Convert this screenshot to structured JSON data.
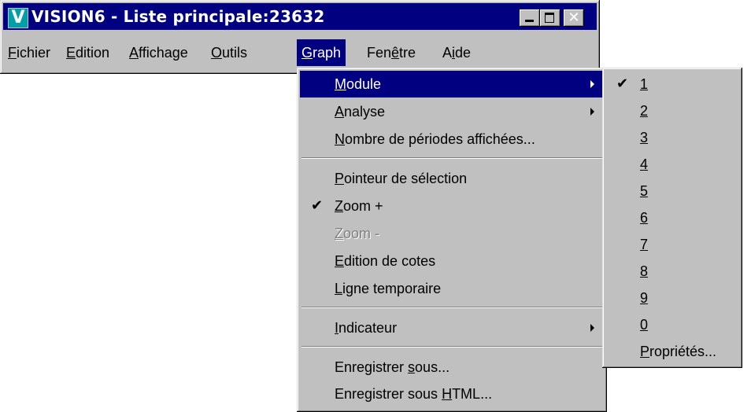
{
  "window": {
    "title": "VISION6 - Liste principale:23632",
    "app_icon_letter": "V",
    "controls": {
      "minimize": "_",
      "maximize": "□",
      "close": "✕"
    }
  },
  "menubar": {
    "items": [
      {
        "pre": "",
        "key": "F",
        "post": "ichier"
      },
      {
        "pre": "",
        "key": "E",
        "post": "dition"
      },
      {
        "pre": "",
        "key": "A",
        "post": "ffichage"
      },
      {
        "pre": "",
        "key": "O",
        "post": "utils"
      },
      {
        "pre": "",
        "key": "G",
        "post": "raph"
      },
      {
        "pre": "Fen",
        "key": "ê",
        "post": "tre"
      },
      {
        "pre": "A",
        "key": "i",
        "post": "de"
      }
    ],
    "active_index": 4
  },
  "graph_menu": {
    "module": {
      "pre": "",
      "key": "M",
      "post": "odule"
    },
    "analyse": {
      "pre": "",
      "key": "A",
      "post": "nalyse"
    },
    "periodes": {
      "pre": "",
      "key": "N",
      "post": "ombre de périodes affichées..."
    },
    "pointeur": {
      "pre": "",
      "key": "P",
      "post": "ointeur de sélection"
    },
    "zoom_plus": {
      "pre": "",
      "key": "Z",
      "post": "oom +",
      "checked": "✔"
    },
    "zoom_minus": {
      "pre": "",
      "key": "Z",
      "post": "oom -"
    },
    "edition_cotes": {
      "pre": "",
      "key": "E",
      "post": "dition de cotes"
    },
    "ligne": {
      "pre": "",
      "key": "L",
      "post": "igne temporaire"
    },
    "indicateur": {
      "pre": "",
      "key": "I",
      "post": "ndicateur"
    },
    "enregistrer": {
      "pre": "Enregistrer ",
      "key": "s",
      "post": "ous..."
    },
    "enregistrer_html": {
      "pre": "Enregistrer sous ",
      "key": "H",
      "post": "TML..."
    }
  },
  "module_menu": {
    "checked_mark": "✔",
    "items": [
      "1",
      "2",
      "3",
      "4",
      "5",
      "6",
      "7",
      "8",
      "9",
      "0"
    ],
    "proprietes": {
      "pre": "",
      "key": "P",
      "post": "ropriétés..."
    }
  }
}
